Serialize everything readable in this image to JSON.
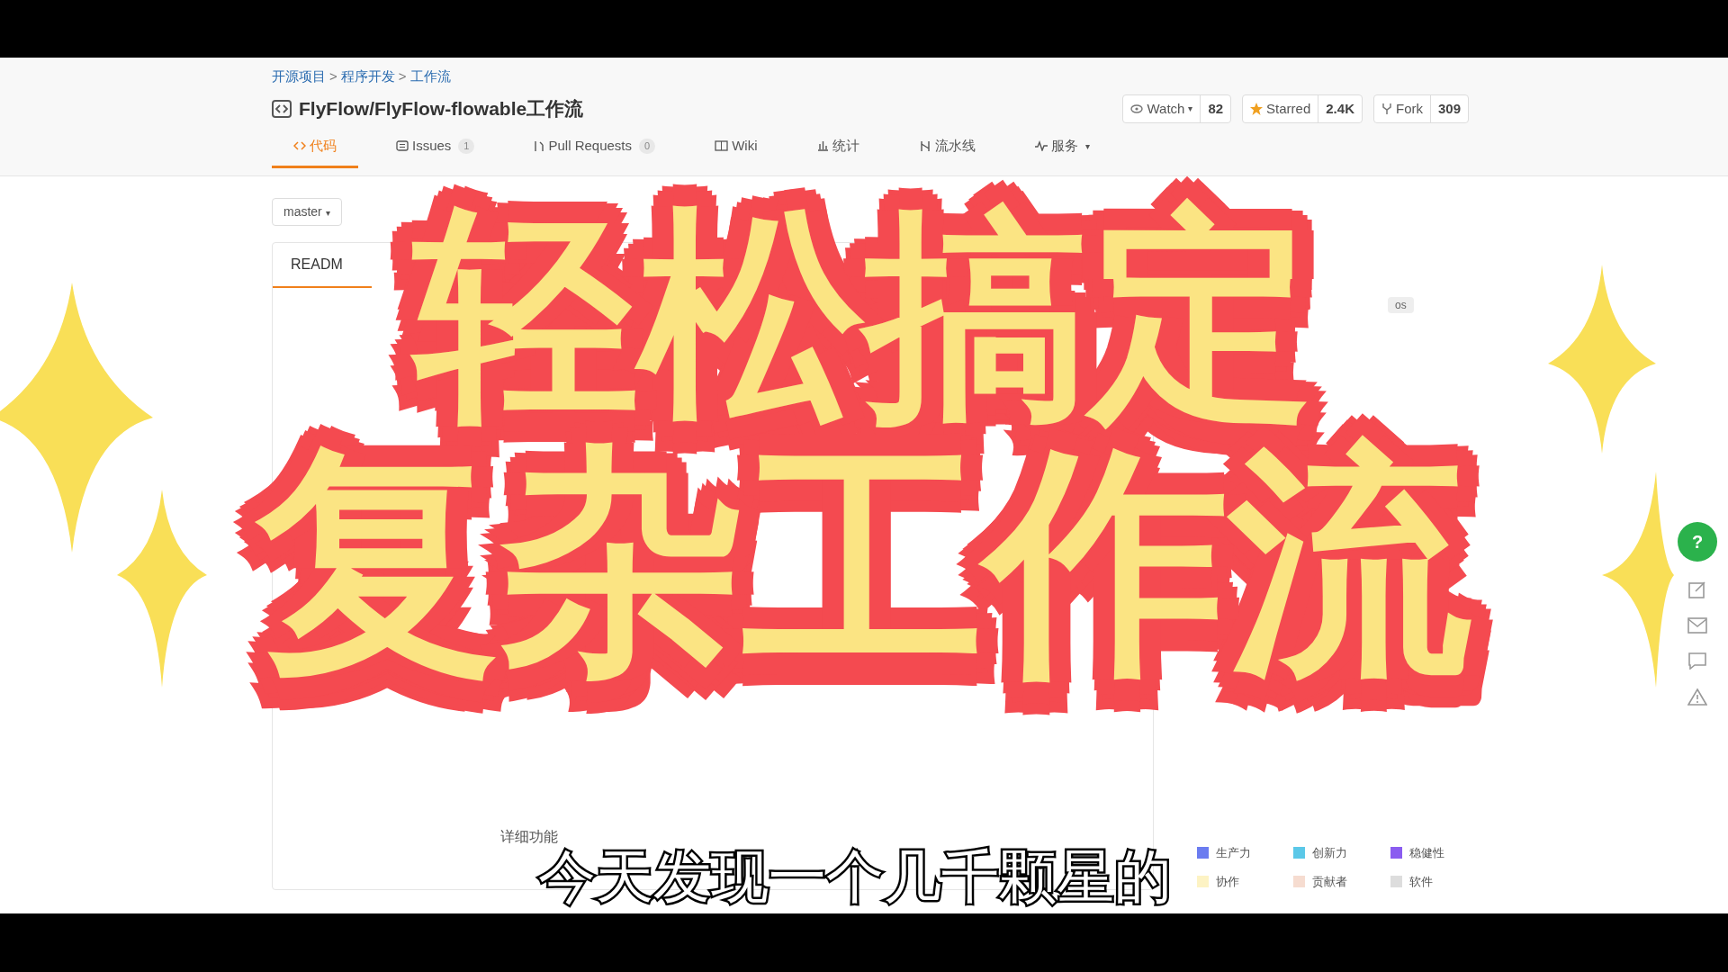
{
  "breadcrumb": [
    "开源项目",
    "程序开发",
    "工作流"
  ],
  "breadcrumb_separator": ">",
  "repo_title": "FlyFlow/FlyFlow-flowable工作流",
  "repo_actions": [
    {
      "label": "Watch",
      "count": "82",
      "kind": "watch",
      "caret": "▾"
    },
    {
      "label": "Starred",
      "count": "2.4K",
      "kind": "star"
    },
    {
      "label": "Fork",
      "count": "309",
      "kind": "fork"
    }
  ],
  "tabs": [
    {
      "label": "代码",
      "selected": true,
      "kind": "code"
    },
    {
      "label": "Issues",
      "count": "1",
      "selected": false,
      "kind": "issues"
    },
    {
      "label": "Pull Requests",
      "count": "0",
      "selected": false,
      "kind": "pr"
    },
    {
      "label": "Wiki",
      "selected": false,
      "kind": "wiki"
    },
    {
      "label": "统计",
      "selected": false,
      "kind": "stats"
    },
    {
      "label": "流水线",
      "selected": false,
      "kind": "pipeline"
    },
    {
      "label": "服务",
      "selected": false,
      "kind": "service",
      "caret": "▾"
    }
  ],
  "branch": "master",
  "branch_caret": "▾",
  "readme_tab_partial": "READM",
  "sidebar_tag": "os",
  "feature_note_partial": "详细功能",
  "legend": [
    {
      "label": "生产力",
      "color": "#6b7cf0"
    },
    {
      "label": "创新力",
      "color": "#5bc8e8"
    },
    {
      "label": "稳健性",
      "color": "#8a5cf0"
    },
    {
      "label": "协作",
      "color": "#fdf3c4"
    },
    {
      "label": "贡献者",
      "color": "#f6dcd0"
    },
    {
      "label": "软件",
      "color": "#dddddd"
    }
  ],
  "overlay_title": [
    "轻松搞定",
    "复杂工作流"
  ],
  "subtitle": "今天发现一个几千颗星的",
  "help_button": "?"
}
